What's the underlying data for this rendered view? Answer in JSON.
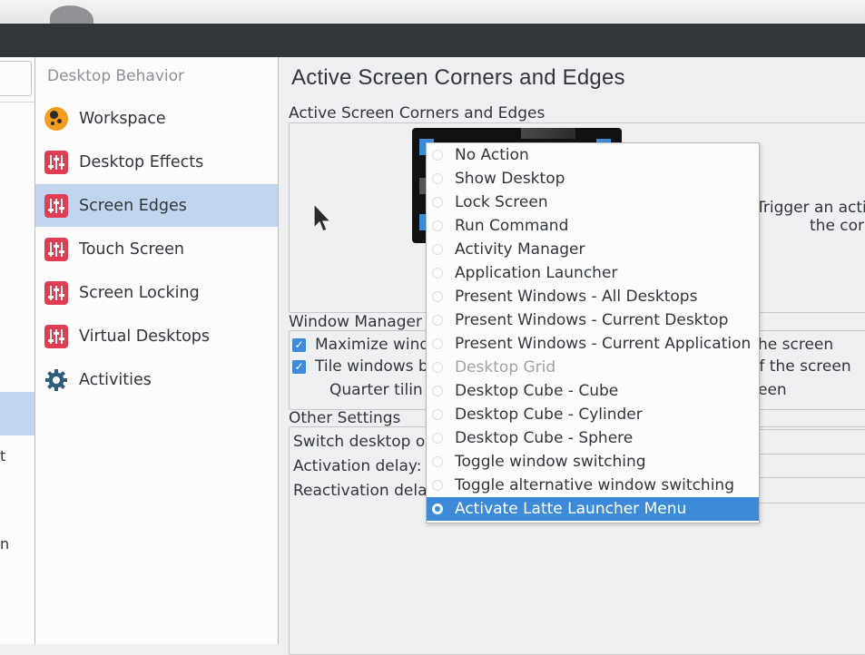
{
  "sidebar": {
    "header": "Desktop Behavior",
    "items": [
      {
        "label": "Workspace",
        "icon": "workspace-icon"
      },
      {
        "label": "Desktop Effects",
        "icon": "sliders-icon"
      },
      {
        "label": "Screen Edges",
        "icon": "sliders-icon",
        "selected": true
      },
      {
        "label": "Touch Screen",
        "icon": "sliders-icon"
      },
      {
        "label": "Screen Locking",
        "icon": "sliders-icon"
      },
      {
        "label": "Virtual Desktops",
        "icon": "sliders-icon"
      },
      {
        "label": "Activities",
        "icon": "gear-icon"
      }
    ]
  },
  "left_strip": {
    "fragments": [
      "t",
      "n"
    ]
  },
  "main": {
    "title": "Active Screen Corners and Edges",
    "corners_group": {
      "title": "Active Screen Corners and Edges",
      "hint_line1": "Trigger an acti",
      "hint_line2": "the corn"
    },
    "window_mgmt": {
      "title": "Window Manager",
      "maximize_label": "Maximize wind",
      "maximize_tail": "he screen",
      "tile_label": "Tile windows b",
      "tile_tail": "of the screen",
      "quarter_label": "Quarter tilin",
      "quarter_tail": "een"
    },
    "other": {
      "title": "Other Settings",
      "switch_label": "Switch desktop o",
      "activation_label": "Activation delay:",
      "reactivation_label": "Reactivation dela"
    }
  },
  "menu": {
    "items": [
      {
        "label": "No Action"
      },
      {
        "label": "Show Desktop"
      },
      {
        "label": "Lock Screen"
      },
      {
        "label": "Run Command"
      },
      {
        "label": "Activity Manager"
      },
      {
        "label": "Application Launcher"
      },
      {
        "label": "Present Windows - All Desktops"
      },
      {
        "label": "Present Windows - Current Desktop"
      },
      {
        "label": "Present Windows - Current Application"
      },
      {
        "label": "Desktop Grid",
        "disabled": true
      },
      {
        "label": "Desktop Cube - Cube"
      },
      {
        "label": "Desktop Cube - Cylinder"
      },
      {
        "label": "Desktop Cube - Sphere"
      },
      {
        "label": "Toggle window switching"
      },
      {
        "label": "Toggle alternative window switching"
      },
      {
        "label": "Activate Latte Launcher Menu",
        "selected": true
      }
    ]
  },
  "colors": {
    "accent": "#3d8bd8",
    "selection": "#c2d5ef",
    "titlebar": "#31363b",
    "icon_red": "#e03d55",
    "icon_orange": "#f39c1f"
  }
}
